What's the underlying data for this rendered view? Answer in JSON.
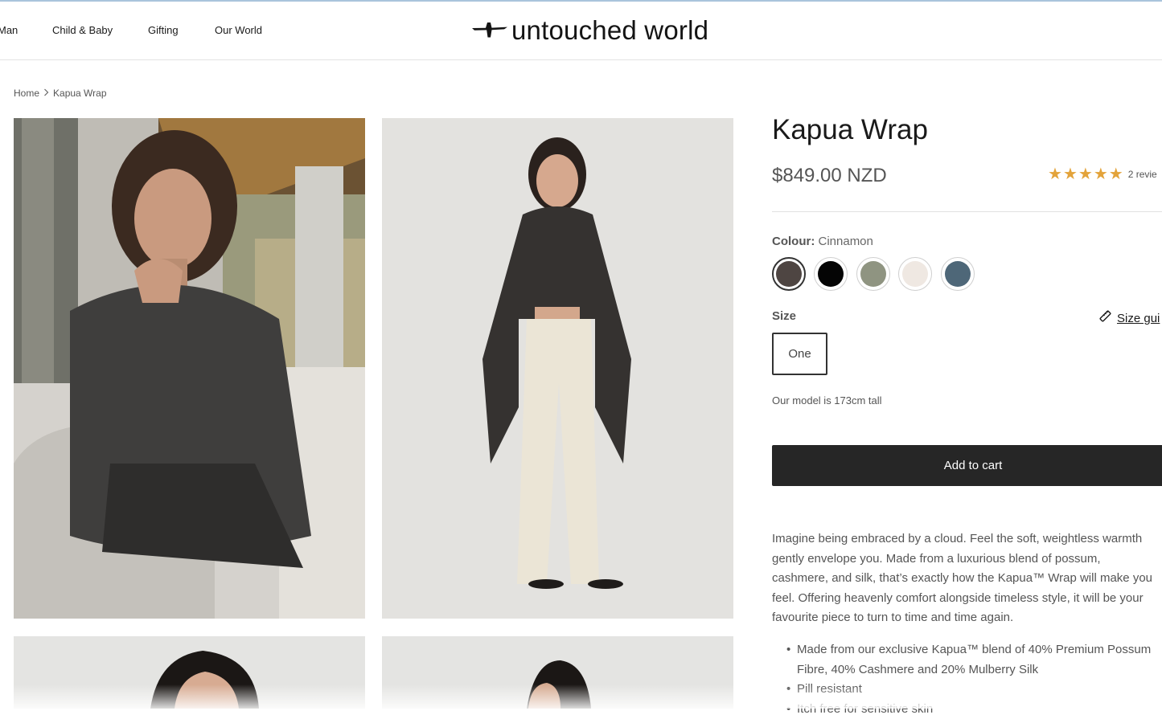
{
  "nav": {
    "items": [
      {
        "label": "Man"
      },
      {
        "label": "Child & Baby"
      },
      {
        "label": "Gifting"
      },
      {
        "label": "Our World"
      }
    ]
  },
  "logo": {
    "text": "untouched world",
    "icon": "bird-icon"
  },
  "breadcrumb": {
    "home": "Home",
    "separator_icon": "chevron-right-icon",
    "current": "Kapua Wrap"
  },
  "product": {
    "title": "Kapua Wrap",
    "price": "$849.00 NZD",
    "rating": {
      "stars": 5,
      "max": 5,
      "reviews_label": "2 revie"
    },
    "colour": {
      "label": "Colour:",
      "selected": "Cinnamon",
      "swatches": [
        {
          "color": "#4e4542",
          "selected": true
        },
        {
          "color": "#050505",
          "selected": false
        },
        {
          "color": "#8f9481",
          "selected": false
        },
        {
          "color": "#efe8e2",
          "selected": false
        },
        {
          "color": "#4e6778",
          "selected": false
        }
      ]
    },
    "size": {
      "label": "Size",
      "guide_label": "Size gui",
      "guide_icon": "ruler-icon",
      "options": [
        "One"
      ]
    },
    "model_note": "Our model is 173cm tall",
    "add_to_cart": "Add to cart",
    "description": [
      "Imagine being embraced by a cloud. Feel the soft, weightless warmth",
      "gently envelope you. Made from a luxurious blend of possum,",
      "cashmere, and silk, that’s exactly how the Kapua™ Wrap will make you",
      "feel. Offering heavenly comfort alongside timeless style, it will be your",
      "favourite piece to turn to time and time again."
    ],
    "features": [
      "Made from our exclusive Kapua™ blend of 40% Premium Possum",
      "Fibre, 40% Cashmere and 20% Mulberry Silk",
      "Pill resistant",
      "Itch free for sensitive skin"
    ]
  },
  "colors": {
    "accent_line": "#a9c4dc",
    "star": "#e3a33a",
    "cart_button": "#262626"
  }
}
